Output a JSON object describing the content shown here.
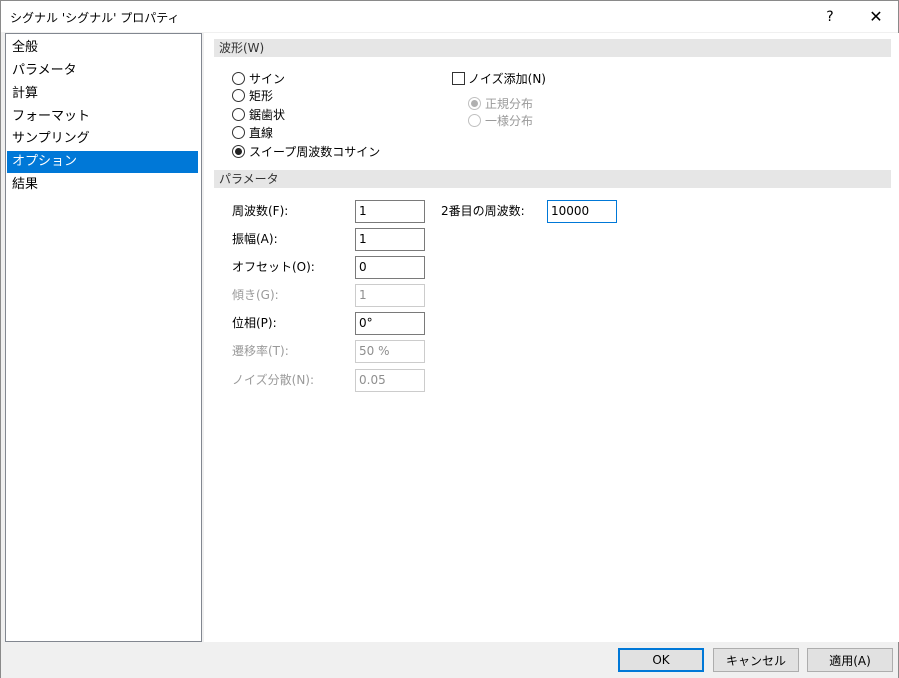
{
  "window": {
    "title": "シグナル 'シグナル' プロパティ",
    "help_label": "?",
    "close_label": "✕"
  },
  "sidebar": {
    "items": [
      {
        "label": "全般"
      },
      {
        "label": "パラメータ"
      },
      {
        "label": "計算"
      },
      {
        "label": "フォーマット"
      },
      {
        "label": "サンプリング"
      },
      {
        "label": "オプション",
        "selected": true
      },
      {
        "label": "結果"
      }
    ]
  },
  "waveform": {
    "header": "波形(W)",
    "options": [
      {
        "label": "サイン",
        "checked": false
      },
      {
        "label": "矩形",
        "checked": false
      },
      {
        "label": "鋸歯状",
        "checked": false
      },
      {
        "label": "直線",
        "checked": false
      },
      {
        "label": "スイープ周波数コサイン",
        "checked": true
      }
    ],
    "noise_checkbox": {
      "label": "ノイズ添加(N)",
      "checked": false
    },
    "noise_distribution": [
      {
        "label": "正規分布",
        "checked": true,
        "disabled": true
      },
      {
        "label": "一様分布",
        "checked": false,
        "disabled": true
      }
    ]
  },
  "parameters": {
    "header": "パラメータ",
    "fields": [
      {
        "label": "周波数(F):",
        "value": "1",
        "disabled": false
      },
      {
        "label": "振幅(A):",
        "value": "1",
        "disabled": false
      },
      {
        "label": "オフセット(O):",
        "value": "0",
        "disabled": false
      },
      {
        "label": "傾き(G):",
        "value": "1",
        "disabled": true
      },
      {
        "label": "位相(P):",
        "value": "0°",
        "disabled": false
      },
      {
        "label": "遷移率(T):",
        "value": "50 %",
        "disabled": true
      },
      {
        "label": "ノイズ分散(N):",
        "value": "0.05",
        "disabled": true
      }
    ],
    "second_frequency": {
      "label": "2番目の周波数:",
      "value": "10000"
    }
  },
  "footer": {
    "ok_label": "OK",
    "cancel_label": "キャンセル",
    "apply_label": "適用(A)"
  },
  "colors": {
    "accent": "#0078d7",
    "group_header_bg": "#e6e6e6",
    "disabled_text": "#9a9a9a"
  }
}
